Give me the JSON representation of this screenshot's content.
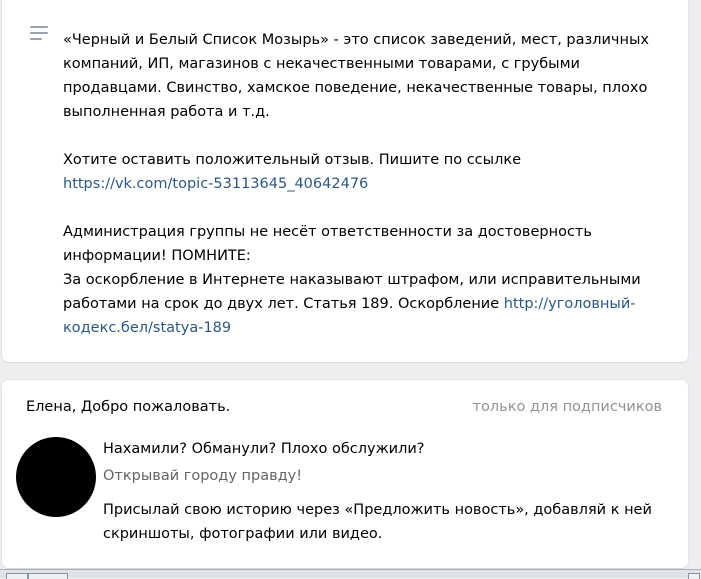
{
  "description": {
    "para1": "«Черный и Белый Список Мозырь» - это список заведений, мест, различных компаний, ИП, магазинов с некачественными товарами, с грубыми продавцами. Свинство, хамское поведение, некачественные товары, плохо выполненная работа и т.д.",
    "para2": "Хотите оставить положительный отзыв. Пишите по ссылке",
    "link1": "https://vk.com/topic-53113645_40642476",
    "para3a": "Администрация группы не несёт ответственности за достоверность информации! ПОМНИТЕ:",
    "para3b": "За оскорбление в Интернете наказывают штрафом, или исправительными работами на срок до двух лет. Статья 189. Оскорбление",
    "link2": "http://уголовный-кодекс.бел/statya-189"
  },
  "welcome": {
    "title": "Елена, Добро пожаловать.",
    "audience": "только для подписчиков",
    "line1": "Нахамили? Обманули? Плохо обслужили?",
    "line2": "Открывай городу правду!",
    "line3": "Присылай свою историю через «Предложить новость», добавляй к ней скриншоты, фотографии или видео."
  },
  "icons": {
    "description": "menu-lines-icon"
  },
  "colors": {
    "link": "#2a5885",
    "muted": "#939393",
    "background": "#edeef0"
  }
}
